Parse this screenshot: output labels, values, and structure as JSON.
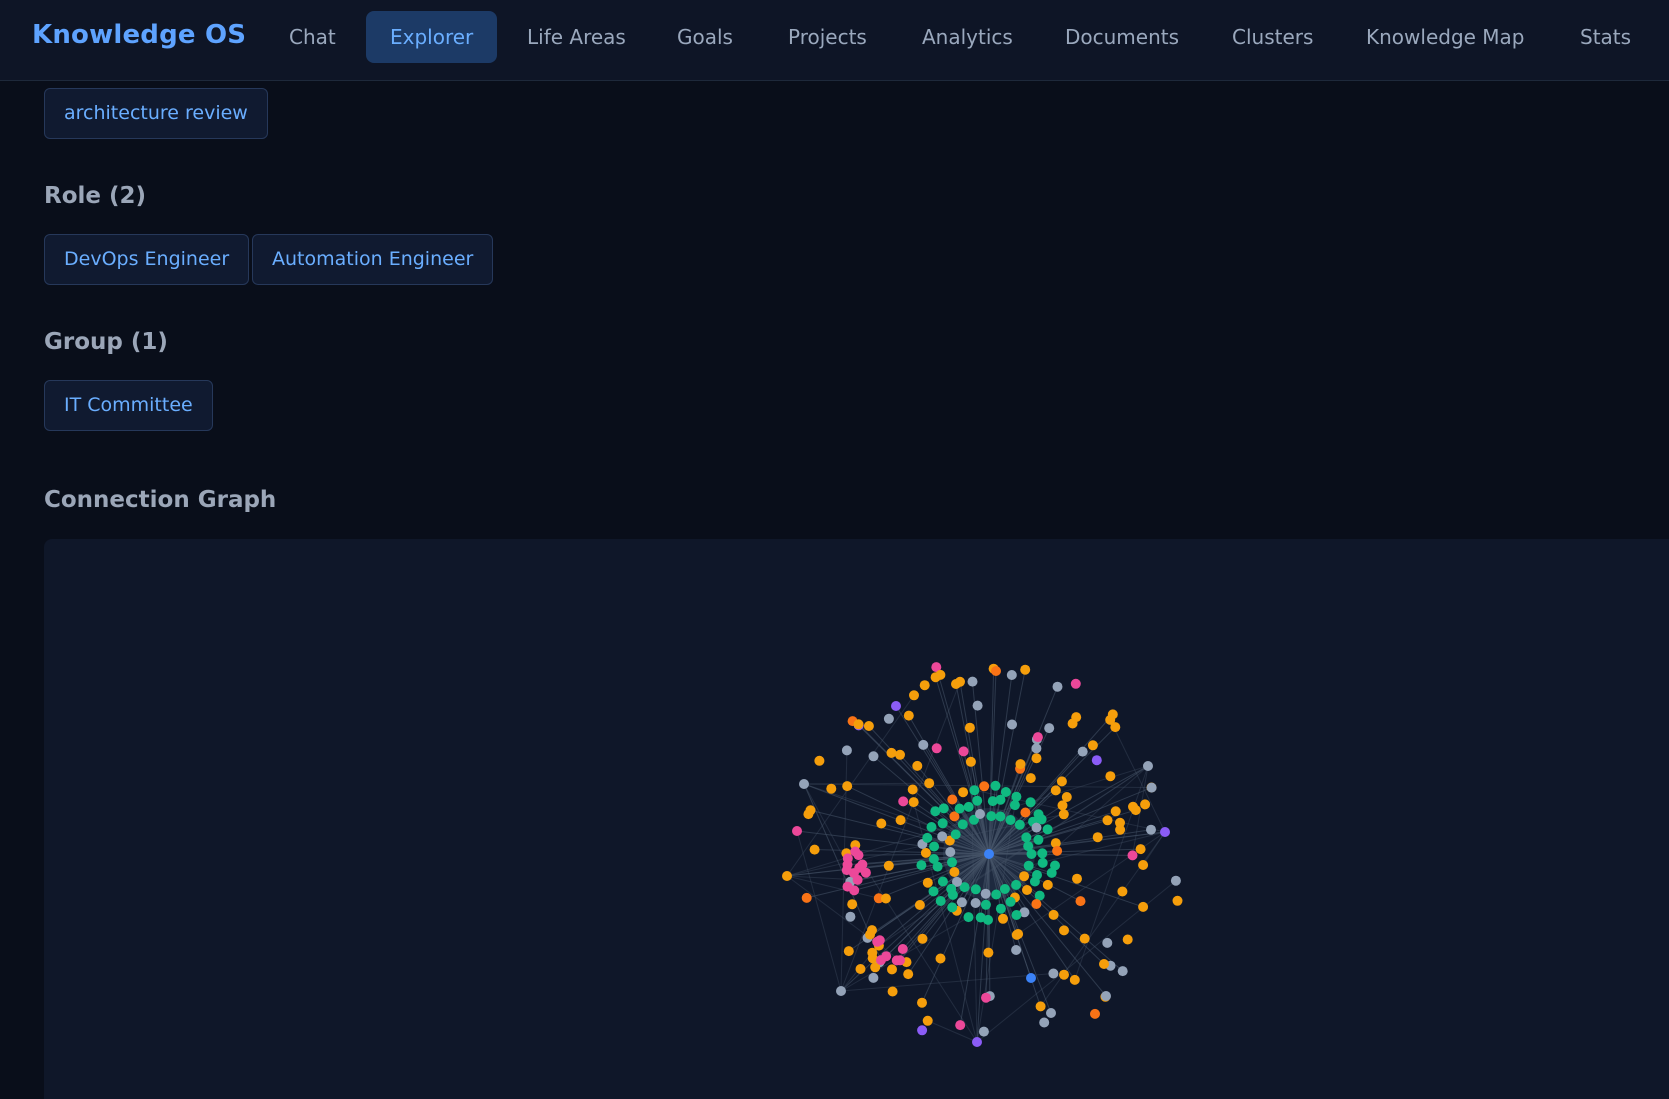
{
  "app": {
    "brand": "Knowledge OS",
    "nav": [
      {
        "label": "Chat",
        "active": false
      },
      {
        "label": "Explorer",
        "active": true
      },
      {
        "label": "Life Areas",
        "active": false
      },
      {
        "label": "Goals",
        "active": false
      },
      {
        "label": "Projects",
        "active": false
      },
      {
        "label": "Analytics",
        "active": false
      },
      {
        "label": "Documents",
        "active": false
      },
      {
        "label": "Clusters",
        "active": false
      },
      {
        "label": "Knowledge Map",
        "active": false
      },
      {
        "label": "Stats",
        "active": false
      }
    ]
  },
  "tags": {
    "top_chip": "architecture review"
  },
  "role": {
    "title": "Role (2)",
    "chips": [
      "DevOps Engineer",
      "Automation Engineer"
    ]
  },
  "group": {
    "title": "Group (1)",
    "chips": [
      "IT Committee"
    ]
  },
  "graph": {
    "title": "Connection Graph",
    "colors": {
      "center": "#3b82f6",
      "inner": "#10b981",
      "primary": "#f59e0b",
      "secondary": "#f97316",
      "pink": "#ec4899",
      "gray": "#94a3b8",
      "purple": "#8b5cf6",
      "edge": "#475569"
    }
  }
}
